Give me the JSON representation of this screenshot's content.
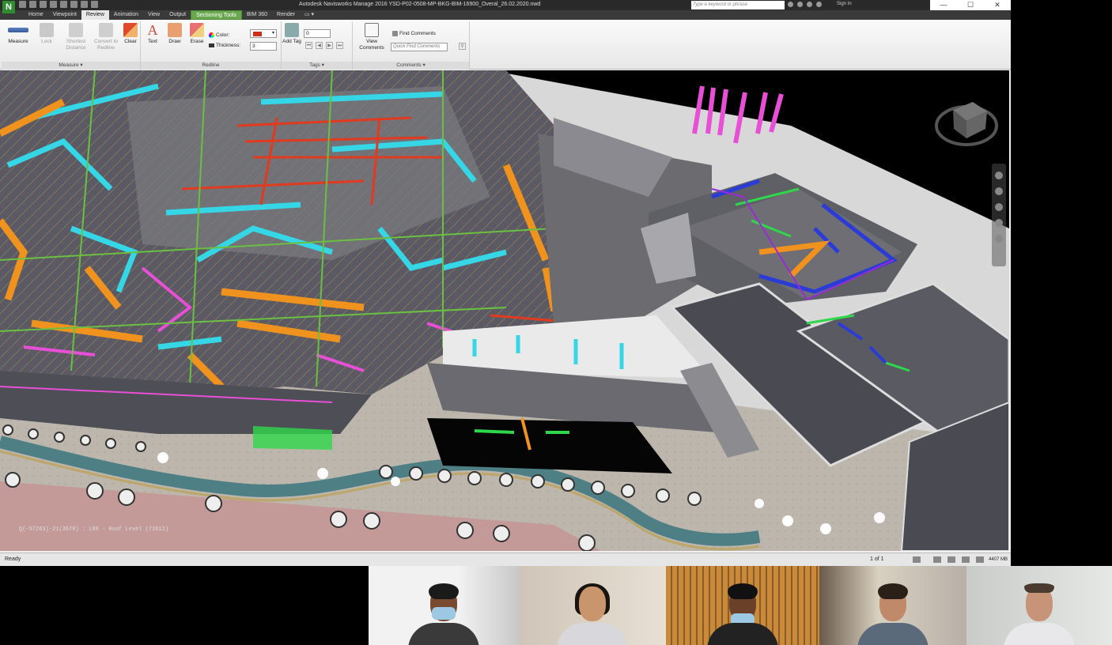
{
  "window": {
    "title": "Autodesk Navisworks Manage 2016     YSD-P02-0508-MP-BKG-BIM-16900_Overal_26.02.2020.nwd",
    "logo": "N",
    "search_placeholder": "Type a keyword or phrase",
    "sign_in": "Sign In",
    "minimize": "—",
    "maximize": "☐",
    "close": "✕"
  },
  "tabs": [
    {
      "label": "Home"
    },
    {
      "label": "Viewpoint"
    },
    {
      "label": "Review"
    },
    {
      "label": "Animation"
    },
    {
      "label": "View"
    },
    {
      "label": "Output"
    },
    {
      "label": "Sectioning Tools"
    },
    {
      "label": "BIM 360"
    },
    {
      "label": "Render"
    }
  ],
  "active_tab": "Review",
  "ribbon": {
    "measure_panel": {
      "title": "Measure ▾",
      "measure": "Measure",
      "lock": "Lock",
      "shortest": "Shortest Distance",
      "convert": "Convert to Redline",
      "clear": "Clear"
    },
    "redline_panel": {
      "title": "Redline",
      "text": "Text",
      "draw": "Draw",
      "erase": "Erase",
      "color_label": "Color:",
      "thickness_label": "Thickness:",
      "thickness_value": "3",
      "color_value": "#d0301b"
    },
    "tags_panel": {
      "title": "Tags ▾",
      "add_tag": "Add Tag",
      "tag_id_value": "0"
    },
    "comments_panel": {
      "title": "Comments ▾",
      "view_comments": "View Comments",
      "find_comments": "Find Comments",
      "quick_find_placeholder": "Quick Find Comments"
    }
  },
  "viewport": {
    "coordinate_readout": "Q(-57263)-21(3670) : L08 - Roof Level (73612)"
  },
  "status": {
    "text": "Ready",
    "page": "1 of 1",
    "memory": "4407 MB"
  },
  "colors": {
    "accent_context_tab": "#6aa84f",
    "duct_cyan": "#35d6e6",
    "duct_orange": "#f0921e",
    "pipe_magenta": "#e84fd6",
    "pipe_green": "#2fd84a",
    "pipe_red": "#e23a1e",
    "duct_blue": "#2a3bd8"
  }
}
